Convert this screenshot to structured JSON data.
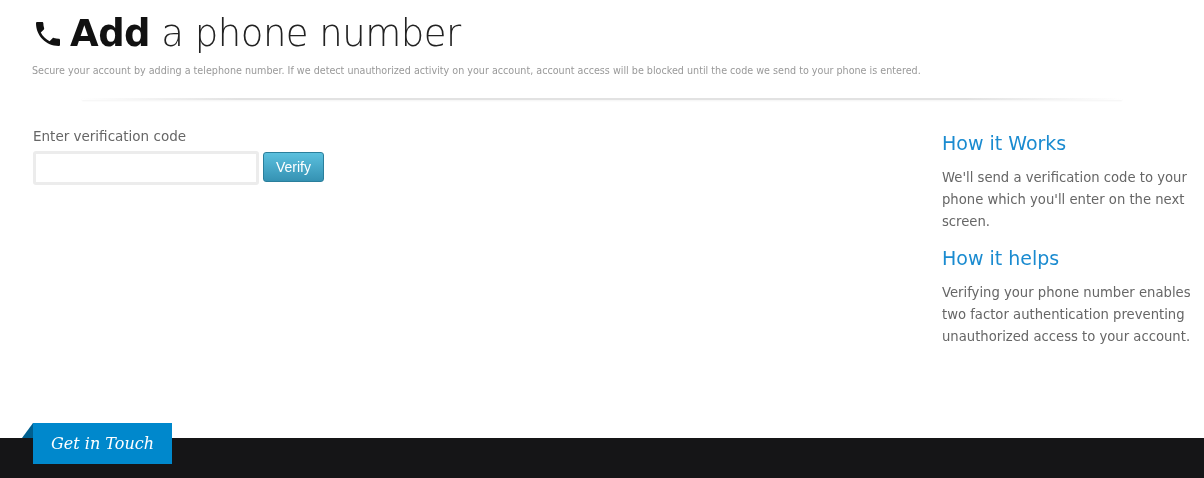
{
  "header": {
    "title": "**Add** a phone number",
    "subtitle": "Secure your account by adding a telephone number. If we detect unauthorized activity on your account, account access will be blocked until the code we send to your phone is entered."
  },
  "form": {
    "label": "Enter verification code",
    "button": "Verify"
  },
  "info": [
    {
      "heading": "How it Works",
      "text": "We'll send a verification code to your phone which you'll enter on the next screen."
    },
    {
      "heading": "How it helps",
      "text": "Verifying your phone number enables two factor authentication preventing unauthorized access to your account."
    }
  ],
  "footer": {
    "tab": "Get in Touch"
  }
}
